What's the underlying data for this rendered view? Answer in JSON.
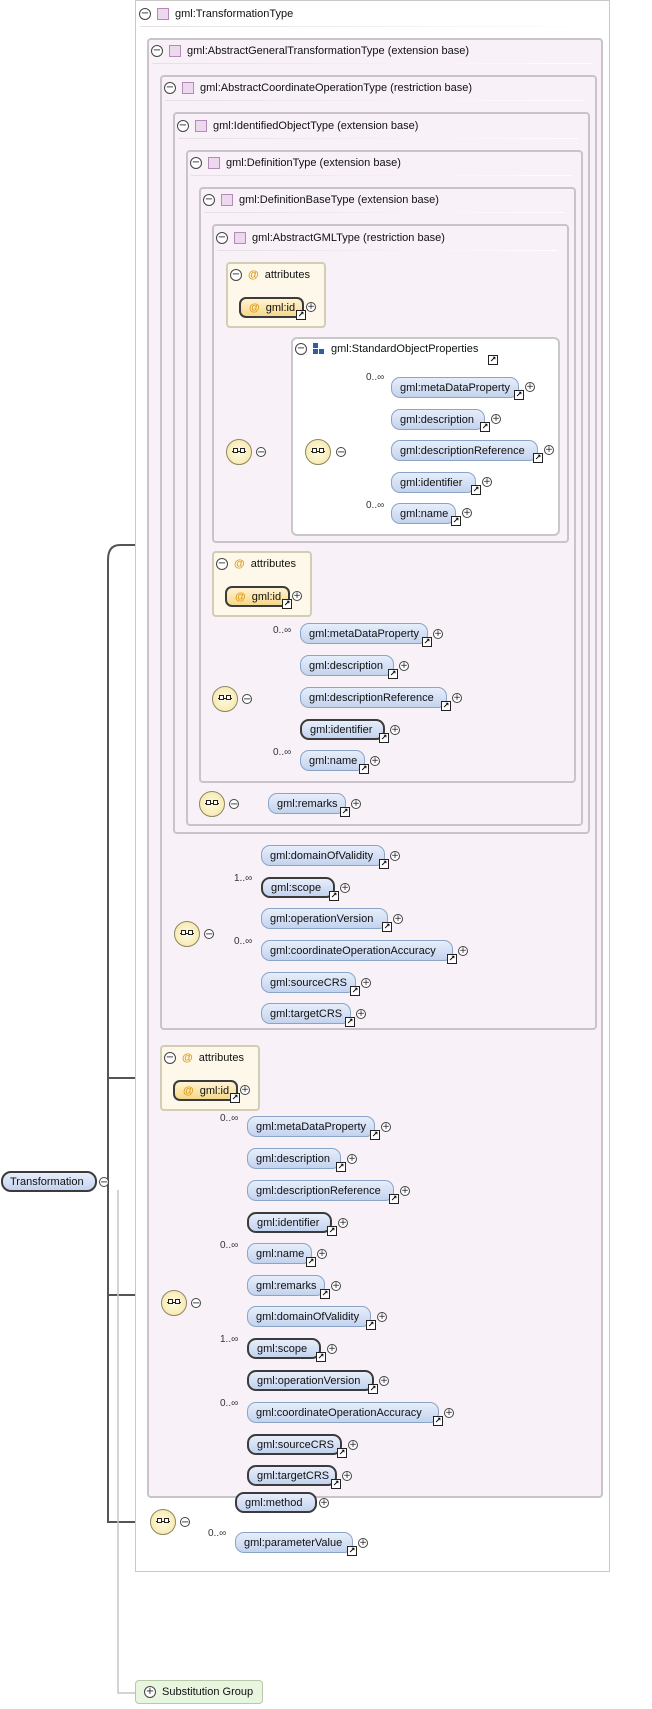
{
  "types": {
    "transformation_type": "gml:TransformationType",
    "abstract_general": "gml:AbstractGeneralTransformationType (extension base)",
    "abstract_coord_op": "gml:AbstractCoordinateOperationType (restriction base)",
    "identified_object": "gml:IdentifiedObjectType (extension base)",
    "definition": "gml:DefinitionType (extension base)",
    "definition_base": "gml:DefinitionBaseType (extension base)",
    "abstract_gml": "gml:AbstractGMLType (restriction base)"
  },
  "group": {
    "standard_object_properties": "gml:StandardObjectProperties"
  },
  "labels": {
    "attributes": "attributes",
    "at": "@",
    "gml_id": "gml:id"
  },
  "elements": {
    "metaDataProperty": "gml:metaDataProperty",
    "description": "gml:description",
    "descriptionReference": "gml:descriptionReference",
    "identifier": "gml:identifier",
    "name": "gml:name",
    "remarks": "gml:remarks",
    "domainOfValidity": "gml:domainOfValidity",
    "scope": "gml:scope",
    "operationVersion": "gml:operationVersion",
    "coordinateOperationAccuracy": "gml:coordinateOperationAccuracy",
    "sourceCRS": "gml:sourceCRS",
    "targetCRS": "gml:targetCRS",
    "method": "gml:method",
    "parameterValue": "gml:parameterValue"
  },
  "cardinality": {
    "zero_many": "0..∞",
    "one_many": "1..∞"
  },
  "root": {
    "label": "Transformation"
  },
  "substitution_group": {
    "label": "Substitution Group"
  },
  "glyphs": {
    "minus": "−",
    "plus": "+",
    "jump": "↗"
  },
  "colors": {
    "element_fill_top": "#e7eefb",
    "element_fill_bottom": "#c3d3ee",
    "type_box_fill": "#f8f1f8",
    "attributes_fill": "#fdf8ea",
    "attribute_accent": "#e09a15",
    "substitution_fill": "#e8f6df"
  }
}
